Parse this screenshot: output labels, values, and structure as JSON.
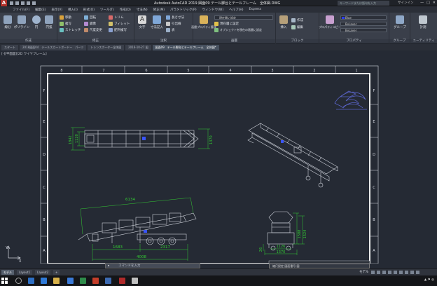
{
  "titlebar": {
    "app_letter": "A",
    "title": "Autodesk AutoCAD 2019   図面09   テール脚台とテールフレーム　全体図.DWG",
    "search_placeholder": "キーワードまたは語句を入力",
    "user": "サインイン",
    "controls": [
      "—",
      "□",
      "✕"
    ]
  },
  "menu": [
    "ファイル(F)",
    "編集(E)",
    "表示(V)",
    "挿入(I)",
    "形式(O)",
    "ツール(T)",
    "作成(D)",
    "寸法(N)",
    "修正(M)",
    "パラメトリック(P)",
    "ウィンドウ(W)",
    "ヘルプ(H)",
    "Express"
  ],
  "ribbon": {
    "groups": {
      "draw": "作成",
      "modify": "修正",
      "annotation": "注釈",
      "layers": "画層",
      "block": "ブロック",
      "properties": "プロパティ",
      "groups": "グループ",
      "utilities": "ユーティリティ"
    },
    "draw_buttons": [
      "線分",
      "ポリライン",
      "円",
      "円弧"
    ],
    "modify_buttons": [
      "移動",
      "回転",
      "トリム",
      "複写",
      "鏡像",
      "フィレット",
      "ストレッチ",
      "尺度変更",
      "配列複写"
    ],
    "annotation_buttons": [
      "文字",
      "寸法記入",
      "長さ寸法",
      "引出線",
      "表"
    ],
    "layer_buttons": [
      "画層プロパティ管理",
      "現在層に設定",
      "オブジェクトを現在の画層に設定"
    ],
    "block_buttons": [
      "挿入",
      "作成",
      "編集"
    ],
    "properties_button": "プロパティコピー",
    "color_value": "Blue",
    "linetype_value": "ByLayer",
    "lineweight_value": "ByLayer",
    "group_button": "グループ",
    "utility_button": "計測"
  },
  "doc_tabs": [
    "スタート",
    "2018図面04　テールスカートボードー　パーツ",
    "トレンスポーター全体図",
    "2016-10-27 図",
    "図面09　テール脚台とテールフレーム　全体図*"
  ],
  "active_tab_index": 4,
  "view_label": "[-][平面図][2D ワイヤフレーム]",
  "drawing": {
    "col_labels": [
      "8",
      "7",
      "6",
      "5",
      "4",
      "3",
      "2",
      "1"
    ],
    "row_labels": [
      "F",
      "E",
      "D",
      "C",
      "B",
      "A"
    ],
    "dims": {
      "top_h1": "1842",
      "top_h2": "1120",
      "top_right": "1370",
      "side_len": "6134",
      "side_a": "1683",
      "side_b": "2317",
      "side_total": "4008",
      "end_h1": "1588",
      "end_h2": "1524",
      "end_w1": "1126",
      "end_w2": "1370",
      "end_small": "26"
    },
    "axis_y": "Y",
    "axis_x": "X",
    "colors": {
      "frame": "#ffffff",
      "dim": "#33cc33",
      "part": "#d0d4dc",
      "accent": "#3a55ff",
      "logo": "#5a64c8"
    }
  },
  "command_line": {
    "placeholder": "コマンドを入力"
  },
  "title_block": {
    "text": "縮尺設定  図面番号  図"
  },
  "status": {
    "layout_tabs": [
      "モデル",
      "Layout1",
      "Layout2",
      "+"
    ],
    "active_layout": 0,
    "mode": "モデル"
  }
}
